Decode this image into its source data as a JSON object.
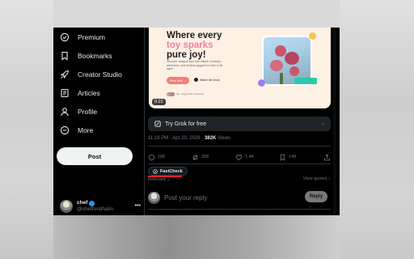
{
  "nav": {
    "items": [
      {
        "label": "Premium",
        "icon": "premium-icon"
      },
      {
        "label": "Bookmarks",
        "icon": "bookmark-icon"
      },
      {
        "label": "Creator Studio",
        "icon": "rocket-icon"
      },
      {
        "label": "Articles",
        "icon": "articles-icon"
      },
      {
        "label": "Profile",
        "icon": "profile-icon"
      },
      {
        "label": "More",
        "icon": "more-icon"
      }
    ],
    "post_label": "Post"
  },
  "account": {
    "name": "chef",
    "handle": "@cheffondhalin",
    "more": "•••"
  },
  "media": {
    "headline_1": "Where every",
    "headline_hl": "toy sparks",
    "headline_2": "pure joy!",
    "subtext": "Discover magical toys that inspire creativity, adventure, and endless giggles for kids of all ages.",
    "cta": "Shop Now →",
    "play_label": "Watch the show",
    "avatars_label": "4k+ happy kids & parents",
    "video_time": "0:22"
  },
  "grok": {
    "label": "Try Grok for free",
    "chevron": "›"
  },
  "meta": {
    "time": "11:18 PM · Apr 20, 2026 · ",
    "views": "382K",
    "views_label": " Views"
  },
  "actions": {
    "replies": "188",
    "reposts": "258",
    "likes": "1.4K",
    "bookmarks": "148"
  },
  "fastcheck": {
    "label": "FastCheck"
  },
  "relevant": "Relevant ⌄",
  "view_quotes": "View quotes ›",
  "reply": {
    "placeholder": "Post your reply",
    "button": "Reply"
  },
  "colors": {
    "accent": "#1d9bf0",
    "highlight": "#f27da5",
    "alert": "#f4212e"
  }
}
